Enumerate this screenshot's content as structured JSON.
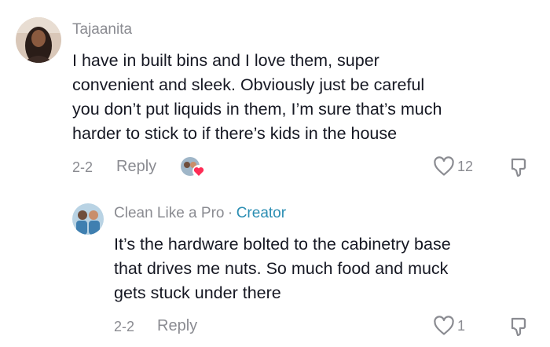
{
  "comments": [
    {
      "username": "Tajaanita",
      "text_lines": [
        "I have in built bins and I love them, super",
        "convenient and sleek. Obviously just be careful",
        "you don’t put liquids in them, I’m sure that’s much",
        "harder to stick to if there’s kids in the house"
      ],
      "date": "2-2",
      "reply_label": "Reply",
      "like_count": "12",
      "creator_liked": true
    },
    {
      "username": "Clean Like a Pro",
      "separator": "·",
      "badge": "Creator",
      "text_lines": [
        "It’s the hardware bolted to the cabinetry base",
        "that drives me nuts. So much food and muck",
        "gets stuck under there"
      ],
      "date": "2-2",
      "reply_label": "Reply",
      "like_count": "1"
    }
  ],
  "colors": {
    "text": "#161823",
    "meta": "#8a8b91",
    "creator_badge": "#2b8eb3",
    "heart_badge": "#fe2c55"
  },
  "icons": {
    "like": "heart-outline-icon",
    "dislike": "thumbs-down-icon",
    "creator_liked": "heart-badge-icon"
  }
}
